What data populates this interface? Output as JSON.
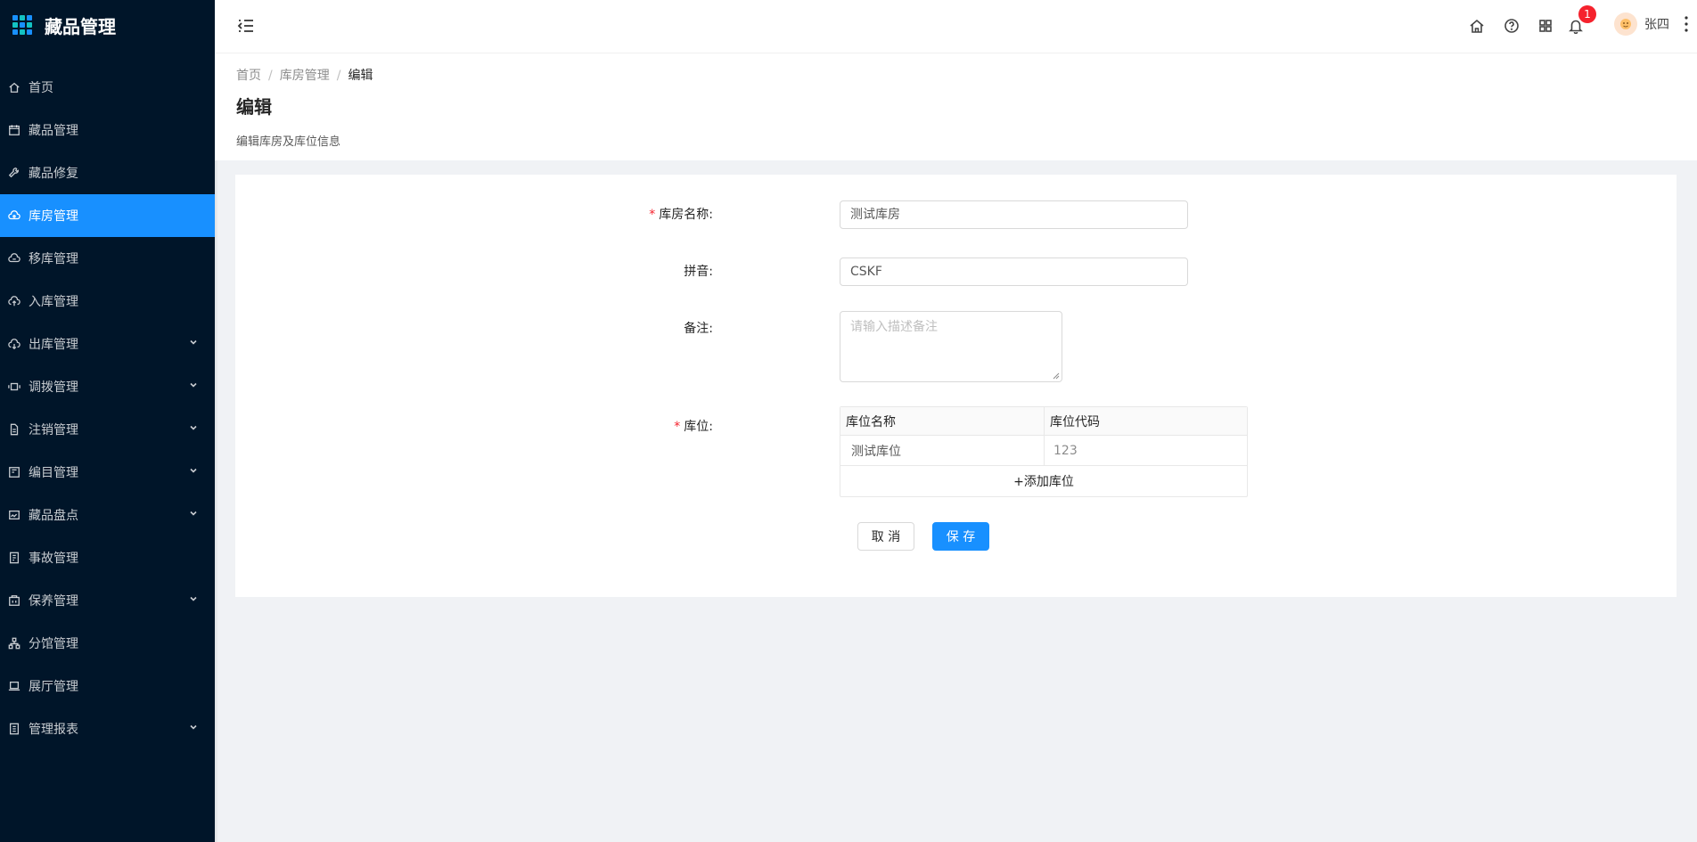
{
  "app": {
    "title": "藏品管理"
  },
  "sidebar": {
    "items": [
      {
        "label": "首页",
        "icon": "home-icon",
        "active": false,
        "submenu": false
      },
      {
        "label": "藏品管理",
        "icon": "calendar-icon",
        "active": false,
        "submenu": false
      },
      {
        "label": "藏品修复",
        "icon": "tool-icon",
        "active": false,
        "submenu": false
      },
      {
        "label": "库房管理",
        "icon": "cloud-icon",
        "active": true,
        "submenu": false
      },
      {
        "label": "移库管理",
        "icon": "cloud-sync-icon",
        "active": false,
        "submenu": false
      },
      {
        "label": "入库管理",
        "icon": "cloud-upload-icon",
        "active": false,
        "submenu": false
      },
      {
        "label": "出库管理",
        "icon": "cloud-download-icon",
        "active": false,
        "submenu": true
      },
      {
        "label": "调拨管理",
        "icon": "transfer-icon",
        "active": false,
        "submenu": true
      },
      {
        "label": "注销管理",
        "icon": "file-icon",
        "active": false,
        "submenu": true
      },
      {
        "label": "编目管理",
        "icon": "catalog-icon",
        "active": false,
        "submenu": true
      },
      {
        "label": "藏品盘点",
        "icon": "inventory-icon",
        "active": false,
        "submenu": true
      },
      {
        "label": "事故管理",
        "icon": "accident-icon",
        "active": false,
        "submenu": false
      },
      {
        "label": "保养管理",
        "icon": "maintenance-icon",
        "active": false,
        "submenu": true
      },
      {
        "label": "分馆管理",
        "icon": "cluster-icon",
        "active": false,
        "submenu": false
      },
      {
        "label": "展厅管理",
        "icon": "laptop-icon",
        "active": false,
        "submenu": false
      },
      {
        "label": "管理报表",
        "icon": "report-icon",
        "active": false,
        "submenu": true
      }
    ]
  },
  "header": {
    "notification_count": "1",
    "username": "张四"
  },
  "breadcrumb": {
    "home": "首页",
    "section": "库房管理",
    "current": "编辑",
    "separator": "/"
  },
  "page": {
    "title": "编辑",
    "description": "编辑库房及库位信息"
  },
  "form": {
    "name_label": "库房名称:",
    "name_value": "测试库房",
    "pinyin_label": "拼音:",
    "pinyin_value": "CSKF",
    "note_label": "备注:",
    "note_placeholder": "请输入描述备注",
    "location_label": "库位:",
    "required_mark": "*",
    "table": {
      "headers": [
        "库位名称",
        "库位代码"
      ],
      "rows": [
        {
          "name": "测试库位",
          "code": "123"
        }
      ],
      "add_label": "+添加库位"
    },
    "cancel_label": "取 消",
    "save_label": "保 存"
  },
  "colors": {
    "sidebar_bg": "#001529",
    "primary": "#1890ff",
    "badge": "#f5222d"
  }
}
